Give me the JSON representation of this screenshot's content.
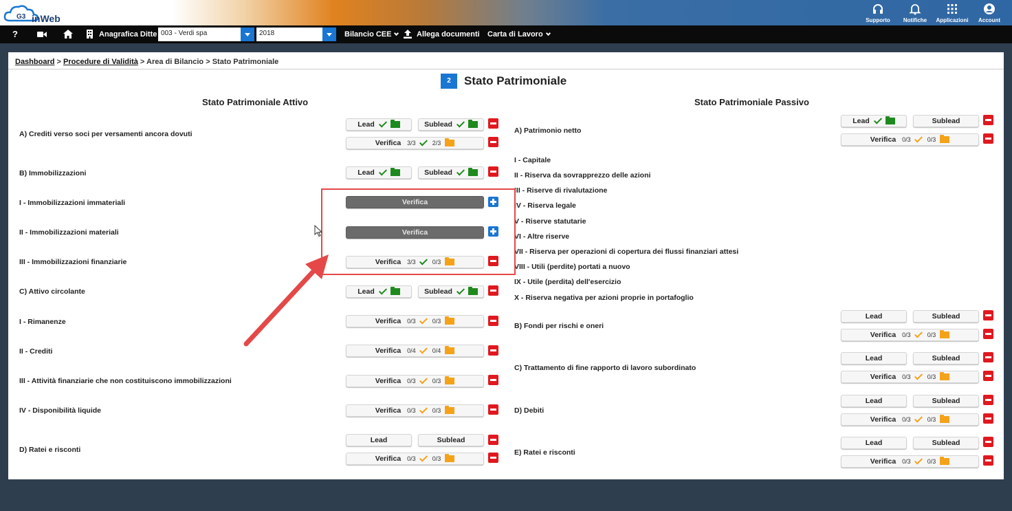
{
  "header": {
    "logo_text": "inWeb",
    "logo_mark": "G3",
    "items": [
      {
        "label": "Supporto",
        "icon": "headphones-icon"
      },
      {
        "label": "Notifiche",
        "icon": "bell-icon"
      },
      {
        "label": "Applicazioni",
        "icon": "grid-icon"
      },
      {
        "label": "Account",
        "icon": "account-icon"
      }
    ]
  },
  "navbar": {
    "help": "?",
    "anagrafica_label": "Anagrafica Ditte",
    "ditta_value": "003 - Verdi spa",
    "year_value": "2018",
    "bilancio_label": "Bilancio CEE",
    "allega_label": "Allega documenti",
    "carta_label": "Carta di Lavoro"
  },
  "breadcrumb": {
    "dashboard": "Dashboard",
    "sep": ">",
    "procedure": "Procedure di Validità",
    "area": "Area di Bilancio",
    "current": "Stato Patrimoniale"
  },
  "page": {
    "badge": "2",
    "title": "Stato Patrimoniale",
    "attivo_title": "Stato Patrimoniale Attivo",
    "passivo_title": "Stato Patrimoniale Passivo"
  },
  "buttons": {
    "lead": "Lead",
    "sublead": "Sublead",
    "verifica": "Verifica"
  },
  "attivo": [
    {
      "label": "A) Crediti verso soci per versamenti ancora dovuti",
      "verifica_a": "3/3",
      "verifica_b": "2/3"
    },
    {
      "label": "B) Immobilizzazioni"
    },
    {
      "label": "I - Immobilizzazioni immateriali"
    },
    {
      "label": "II - Immobilizzazioni materiali"
    },
    {
      "label": "III - Immobilizzazioni finanziarie",
      "verifica_a": "3/3",
      "verifica_b": "0/3"
    },
    {
      "label": "C) Attivo circolante"
    },
    {
      "label": "I - Rimanenze",
      "verifica_a": "0/3",
      "verifica_b": "0/3"
    },
    {
      "label": "II - Crediti",
      "verifica_a": "0/4",
      "verifica_b": "0/4"
    },
    {
      "label": "III - Attività finanziarie che non costituiscono immobilizzazioni",
      "verifica_a": "0/3",
      "verifica_b": "0/3"
    },
    {
      "label": "IV - Disponibilità liquide",
      "verifica_a": "0/3",
      "verifica_b": "0/3"
    },
    {
      "label": "D) Ratei e risconti",
      "verifica_a": "0/3",
      "verifica_b": "0/3"
    }
  ],
  "passivo": [
    {
      "label": "A) Patrimonio netto",
      "verifica_a": "0/3",
      "verifica_b": "0/3"
    },
    {
      "label": "I - Capitale"
    },
    {
      "label": "II - Riserva da sovrapprezzo delle azioni"
    },
    {
      "label": "III - Riserve di rivalutazione"
    },
    {
      "label": "IV - Riserva legale"
    },
    {
      "label": "V - Riserve statutarie"
    },
    {
      "label": "VI - Altre riserve"
    },
    {
      "label": "VII - Riserva per operazioni di copertura dei flussi finanziari attesi"
    },
    {
      "label": "VIII - Utili (perdite) portati a nuovo"
    },
    {
      "label": "IX - Utile (perdita) dell'esercizio"
    },
    {
      "label": "X - Riserva negativa per azioni proprie in portafoglio"
    },
    {
      "label": "B) Fondi per rischi e oneri",
      "verifica_a": "0/3",
      "verifica_b": "0/3"
    },
    {
      "label": "C) Trattamento di fine rapporto di lavoro subordinato",
      "verifica_a": "0/3",
      "verifica_b": "0/3"
    },
    {
      "label": "D) Debiti",
      "verifica_a": "0/3",
      "verifica_b": "0/3"
    },
    {
      "label": "E) Ratei e risconti",
      "verifica_a": "0/3",
      "verifica_b": "0/3"
    }
  ],
  "colors": {
    "accent": "#1976d2",
    "ok": "#1e8a1e",
    "pending": "#f5a21b",
    "remove": "#e0191f",
    "highlight": "#e44848"
  }
}
